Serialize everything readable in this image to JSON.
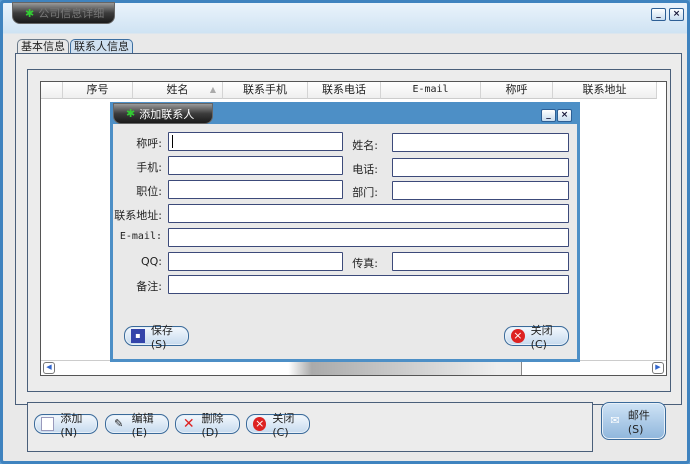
{
  "window": {
    "title": "公司信息详细",
    "min": "_",
    "close": "×"
  },
  "tabs": [
    {
      "label": "基本信息"
    },
    {
      "label": "联系人信息"
    }
  ],
  "grid": {
    "columns": [
      "序号",
      "姓名",
      "联系手机",
      "联系电话",
      "E-mail",
      "称呼",
      "联系地址"
    ],
    "sort_indicator": "▲"
  },
  "dialog": {
    "title": "添加联系人",
    "fields": {
      "title": "称呼:",
      "name": "姓名:",
      "mobile": "手机:",
      "phone": "电话:",
      "position": "职位:",
      "dept": "部门:",
      "address": "联系地址:",
      "email": "E-mail:",
      "qq": "QQ:",
      "fax": "传真:",
      "note": "备注:"
    },
    "save": "保存(S)",
    "close": "关闭(C)"
  },
  "toolbar": {
    "add": "添加(N)",
    "edit": "编辑(E)",
    "delete": "删除(D)",
    "close": "关闭(C)",
    "mail": "邮件(S)"
  }
}
